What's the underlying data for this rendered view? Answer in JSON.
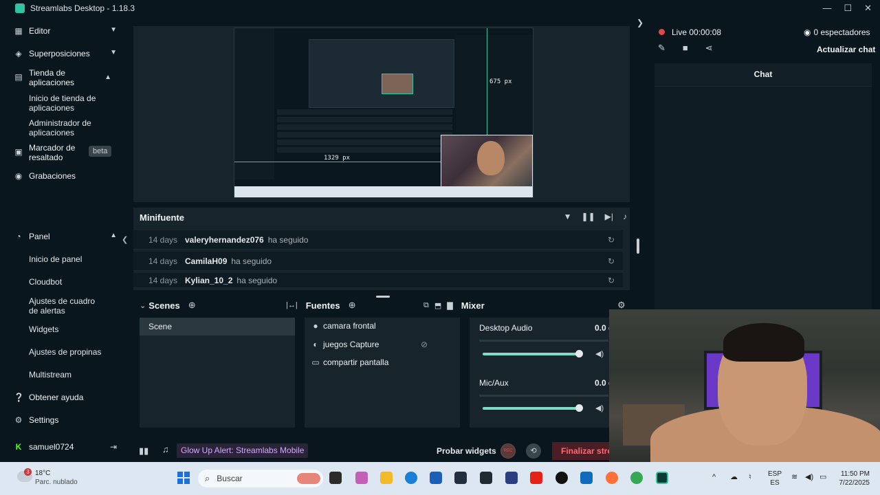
{
  "window": {
    "title": "Streamlabs Desktop - 1.18.3",
    "controls": [
      "—",
      "☐",
      "✕"
    ]
  },
  "sidebar": {
    "editor": "Editor",
    "overlays": "Superposiciones",
    "app_store": "Tienda de aplicaciones",
    "app_store_home": "Inicio de tienda de aplicaciones",
    "app_manager": "Administrador de aplicaciones",
    "highlighter": "Marcador de resaltado",
    "highlighter_badge": "beta",
    "recordings": "Grabaciones",
    "panel": "Panel",
    "panel_home": "Inicio de panel",
    "cloudbot": "Cloudbot",
    "alert_box": "Ajustes de cuadro de alertas",
    "widgets": "Widgets",
    "tips": "Ajustes de propinas",
    "multistream": "Multistream",
    "help": "Obtener ayuda",
    "settings": "Settings",
    "user": "samuel0724"
  },
  "preview": {
    "guide_width": "1329 px",
    "guide_height": "675 px"
  },
  "minifuente": {
    "title": "Minifuente",
    "events": [
      {
        "days": "14 days",
        "user": "valeryhernandez076",
        "action": "ha seguido"
      },
      {
        "days": "14 days",
        "user": "CamilaH09",
        "action": "ha seguido"
      },
      {
        "days": "14 days",
        "user": "Kylian_10_2",
        "action": "ha seguido"
      }
    ]
  },
  "scenes": {
    "title": "Scenes",
    "items": [
      "Scene"
    ]
  },
  "sources": {
    "title": "Fuentes",
    "items": [
      {
        "icon": "camera-icon",
        "label": "camara frontal"
      },
      {
        "icon": "gamepad-icon",
        "label": "juegos Capture"
      },
      {
        "icon": "monitor-icon",
        "label": "compartir pantalla"
      }
    ]
  },
  "mixer": {
    "title": "Mixer",
    "channels": [
      {
        "name": "Desktop Audio",
        "value": "0.0 d",
        "level": 0.98
      },
      {
        "name": "Mic/Aux",
        "value": "0.0 d",
        "level": 0.98
      }
    ]
  },
  "footer": {
    "alert": "Glow Up Alert: Streamlabs Mobile",
    "test_widgets": "Probar widgets",
    "rec": "REC",
    "end_stream": "Finalizar stream"
  },
  "live": {
    "status": "Live 00:00:08",
    "viewers": "0 espectadores",
    "refresh_chat": "Actualizar chat",
    "chat_title": "Chat"
  },
  "taskbar": {
    "weather_badge": "3",
    "temp": "18°C",
    "condition": "Parc. nublado",
    "search": "Buscar",
    "lang_top": "ESP",
    "lang_bottom": "ES",
    "time": "11:50 PM",
    "date": "7/22/2025"
  },
  "colors": {
    "accent": "#31c3a2",
    "live": "#e04848",
    "end_stream": "#ff6b75",
    "alert_text": "#d3a9ff"
  }
}
